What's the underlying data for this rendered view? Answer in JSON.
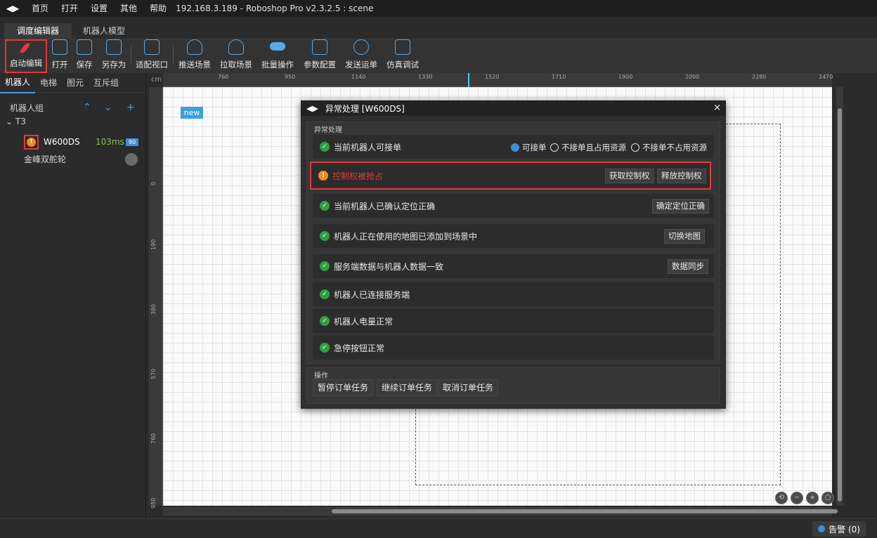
{
  "titlebar": {
    "menus": [
      "首页",
      "打开",
      "设置",
      "其他",
      "帮助"
    ],
    "title": "192.168.3.189 - Roboshop Pro v2.3.2.5 : scene"
  },
  "tabs": {
    "active": "调度编辑器",
    "inactive": "机器人模型"
  },
  "toolbar": {
    "edit": "启动编辑",
    "open": "打开",
    "save": "保存",
    "save_as": "另存为",
    "fit_view": "适配视口",
    "push_scene": "推送场景",
    "pull_scene": "拉取场景",
    "batch": "批量操作",
    "params": "参数配置",
    "send_order": "发送运单",
    "sim_debug": "仿真调试"
  },
  "sidebar": {
    "tabs": [
      "机器人",
      "电梯",
      "图元",
      "互斥组"
    ],
    "group_label": "机器人组",
    "tree_group": "T3",
    "robot": {
      "name": "W600DS",
      "ping": "103ms",
      "battery": "90"
    },
    "model": "金峰双舵轮"
  },
  "canvas": {
    "unit": "cm",
    "scene_tag": "new",
    "ruler_top": [
      "760",
      "950",
      "1140",
      "1330",
      "1520",
      "1710",
      "1900",
      "2090",
      "2280",
      "2470"
    ],
    "ruler_left": [
      "0",
      "190",
      "380",
      "570",
      "760",
      "950"
    ]
  },
  "dialog": {
    "title": "异常处理 [W600DS]",
    "close": "×",
    "section_exceptions": "异常处理",
    "section_ops": "操作",
    "rows": [
      {
        "text": "当前机器人可接单"
      },
      {
        "text": "控制权被抢占"
      },
      {
        "text": "当前机器人已确认定位正确"
      },
      {
        "text": "机器人正在使用的地图已添加到场景中"
      },
      {
        "text": "服务端数据与机器人数据一致"
      },
      {
        "text": "机器人已连接服务端"
      },
      {
        "text": "机器人电量正常"
      },
      {
        "text": "急停按钮正常"
      }
    ],
    "radios": [
      "可接单",
      "不接单且占用资源",
      "不接单不占用资源"
    ],
    "buttons": {
      "acquire_control": "获取控制权",
      "release_control": "释放控制权",
      "confirm_location": "确定定位正确",
      "switch_map": "切换地图",
      "sync_data": "数据同步"
    },
    "ops": [
      "暂停订单任务",
      "继续订单任务",
      "取消订单任务"
    ]
  },
  "status": {
    "alarm": "告警 (0)"
  },
  "colors": {
    "accent": "#3d8fd6",
    "error": "#e53935",
    "ok": "#2ea043",
    "warn": "#f08a24"
  }
}
